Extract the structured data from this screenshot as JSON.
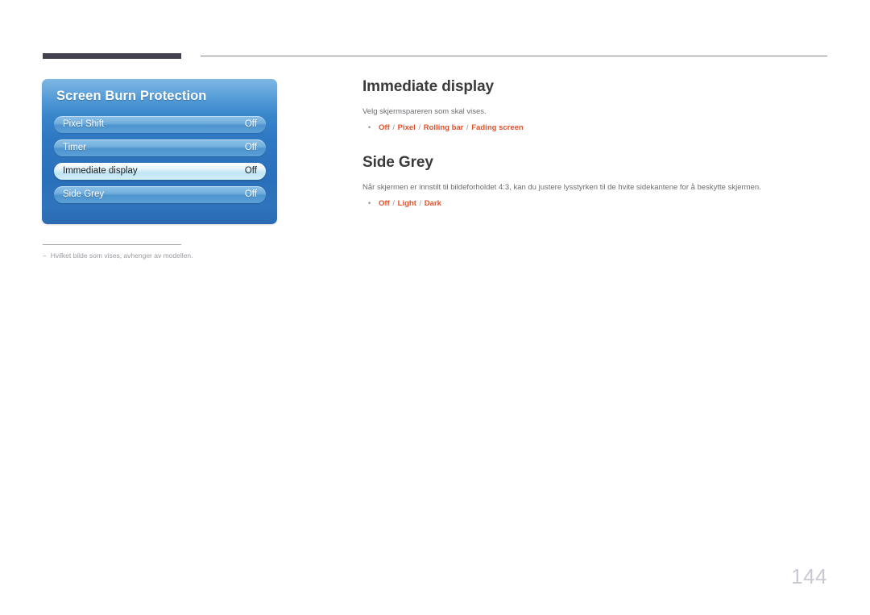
{
  "page": {
    "number": "144",
    "footnote": {
      "marker": "–",
      "text": "Hvilket bilde som vises, avhenger av modellen."
    }
  },
  "osd": {
    "title": "Screen Burn Protection",
    "rows": [
      {
        "label": "Pixel Shift",
        "value": "Off",
        "selected": false
      },
      {
        "label": "Timer",
        "value": "Off",
        "selected": false
      },
      {
        "label": "Immediate display",
        "value": "Off",
        "selected": true
      },
      {
        "label": "Side Grey",
        "value": "Off",
        "selected": false
      }
    ]
  },
  "sections": [
    {
      "title": "Immediate display",
      "body": "Velg skjermspareren som skal vises.",
      "options": [
        "Off",
        "Pixel",
        "Rolling bar",
        "Fading screen"
      ],
      "separator": "/"
    },
    {
      "title": "Side Grey",
      "body": "Når skjermen er innstilt til bildeforholdet 4:3, kan du justere lysstyrken til de hvite sidekantene for å beskytte skjermen.",
      "options": [
        "Off",
        "Light",
        "Dark"
      ],
      "separator": "/"
    }
  ],
  "colors": {
    "accent_orange": "#e2512a",
    "header_bar": "#44414e",
    "panel_blue": "#2f79c3",
    "page_number": "#c9c9d2"
  }
}
